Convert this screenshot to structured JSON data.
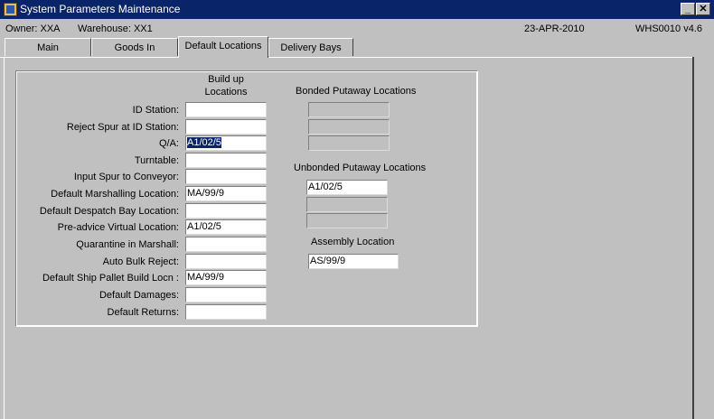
{
  "window": {
    "title": "System Parameters Maintenance"
  },
  "status": {
    "owner": "Owner:  XXA",
    "warehouse": "Warehouse:  XX1",
    "date": "23-APR-2010",
    "form": "WHS0010  v4.6"
  },
  "tabs": [
    "Main",
    "Goods In",
    "Default Locations",
    "Delivery Bays"
  ],
  "build_up": {
    "heading_line1": "Build up",
    "heading_line2": "Locations",
    "rows": [
      {
        "label": "ID Station:",
        "value": ""
      },
      {
        "label": "Reject Spur at ID Station:",
        "value": ""
      },
      {
        "label": "Q/A:",
        "value": "A1/02/5"
      },
      {
        "label": "Turntable:",
        "value": ""
      },
      {
        "label": "Input Spur to Conveyor:",
        "value": ""
      },
      {
        "label": "Default Marshalling Location:",
        "value": "MA/99/9"
      },
      {
        "label": "Default Despatch Bay Location:",
        "value": ""
      },
      {
        "label": "Pre-advice Virtual Location:",
        "value": "A1/02/5"
      },
      {
        "label": "Quarantine in Marshall:",
        "value": ""
      },
      {
        "label": "Auto Bulk Reject:",
        "value": ""
      },
      {
        "label": "Default Ship Pallet Build Locn :",
        "value": "MA/99/9"
      },
      {
        "label": "Default Damages:",
        "value": ""
      },
      {
        "label": "Default Returns:",
        "value": ""
      }
    ]
  },
  "bonded": {
    "heading": "Bonded Putaway Locations",
    "values": [
      "",
      "",
      ""
    ]
  },
  "unbonded": {
    "heading": "Unbonded Putaway Locations",
    "values": [
      "A1/02/5",
      "",
      ""
    ]
  },
  "assembly": {
    "heading": "Assembly Location",
    "value": "AS/99/9"
  },
  "colors": {
    "title_bar": "#0a246a",
    "face": "#c0c0c0",
    "selection": "#0a246a"
  }
}
